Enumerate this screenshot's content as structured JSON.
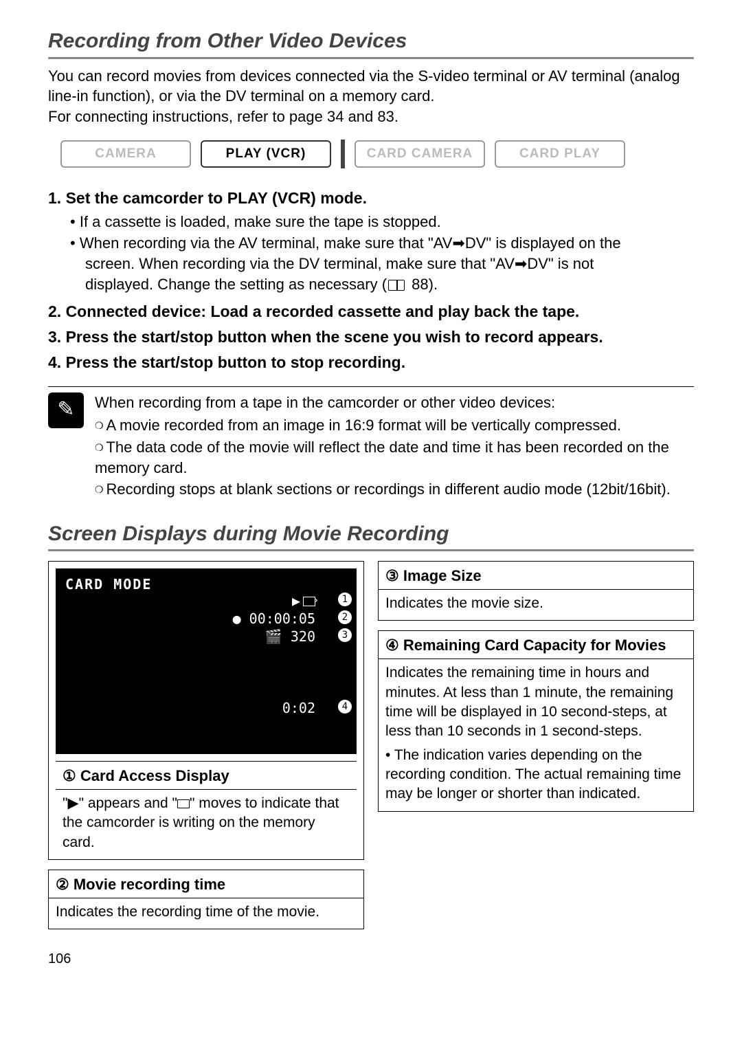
{
  "section1": {
    "heading": "Recording from Other Video Devices",
    "intro1": "You can record movies from devices connected via the S-video terminal or AV terminal (analog line-in function), or via the DV terminal on a memory card.",
    "intro2": "For connecting instructions, refer to page 34 and 83.",
    "modes": {
      "camera": "CAMERA",
      "play_vcr": "PLAY (VCR)",
      "card_camera": "CARD CAMERA",
      "card_play": "CARD PLAY"
    },
    "step1": "1. Set the camcorder to PLAY (VCR) mode.",
    "step1_b1": "If a cassette is loaded, make sure the tape is stopped.",
    "step1_b2a": "When recording via the AV terminal, make sure that \"AV➡DV\" is displayed on the",
    "step1_b2b": "screen. When recording via the DV terminal, make sure that \"AV➡DV\" is not",
    "step1_b2c_prefix": "displayed. Change the setting as necessary (",
    "step1_b2c_page": " 88).",
    "step2": "2. Connected device: Load a recorded cassette and play back the tape.",
    "step3": "3. Press the start/stop button when the scene you wish to record appears.",
    "step4": "4. Press the start/stop button to stop recording.",
    "note_intro": "When recording from a tape in the camcorder or other video devices:",
    "note_b1": "A movie recorded from an image in 16:9 format will be vertically compressed.",
    "note_b2": "The data code of the movie will reflect the date and time it has been recorded on the memory card.",
    "note_b3": "Recording stops at blank sections or recordings in different audio mode (12bit/16bit)."
  },
  "section2": {
    "heading": "Screen Displays during Movie Recording",
    "screen": {
      "card_mode": "CARD MODE",
      "line1": "▶",
      "line2": "● 00:00:05",
      "line3": "🎬 320",
      "line4": "0:02"
    },
    "callouts": {
      "c1": "1",
      "c2": "2",
      "c3": "3",
      "c4": "4"
    },
    "card1_title_num": "①",
    "card1_title": " Card Access Display",
    "card1_body_a": "\"▶\" appears and \"",
    "card1_body_b": "\" moves to indicate that the camcorder is writing on the memory card.",
    "card2_title_num": "②",
    "card2_title": " Movie recording time",
    "card2_body": "Indicates the recording time of the movie.",
    "card3_title_num": "③",
    "card3_title": " Image Size",
    "card3_body": "Indicates the movie size.",
    "card4_title_num": "④",
    "card4_title": " Remaining Card Capacity for Movies",
    "card4_body": "Indicates the remaining time in hours and minutes. At less than 1 minute, the remaining time will be displayed in 10 second-steps, at less than 10 seconds in 1 second-steps.",
    "card4_bullet": "The indication varies depending on the recording condition. The actual remaining time may be longer or shorter than indicated."
  },
  "page_number": "106"
}
